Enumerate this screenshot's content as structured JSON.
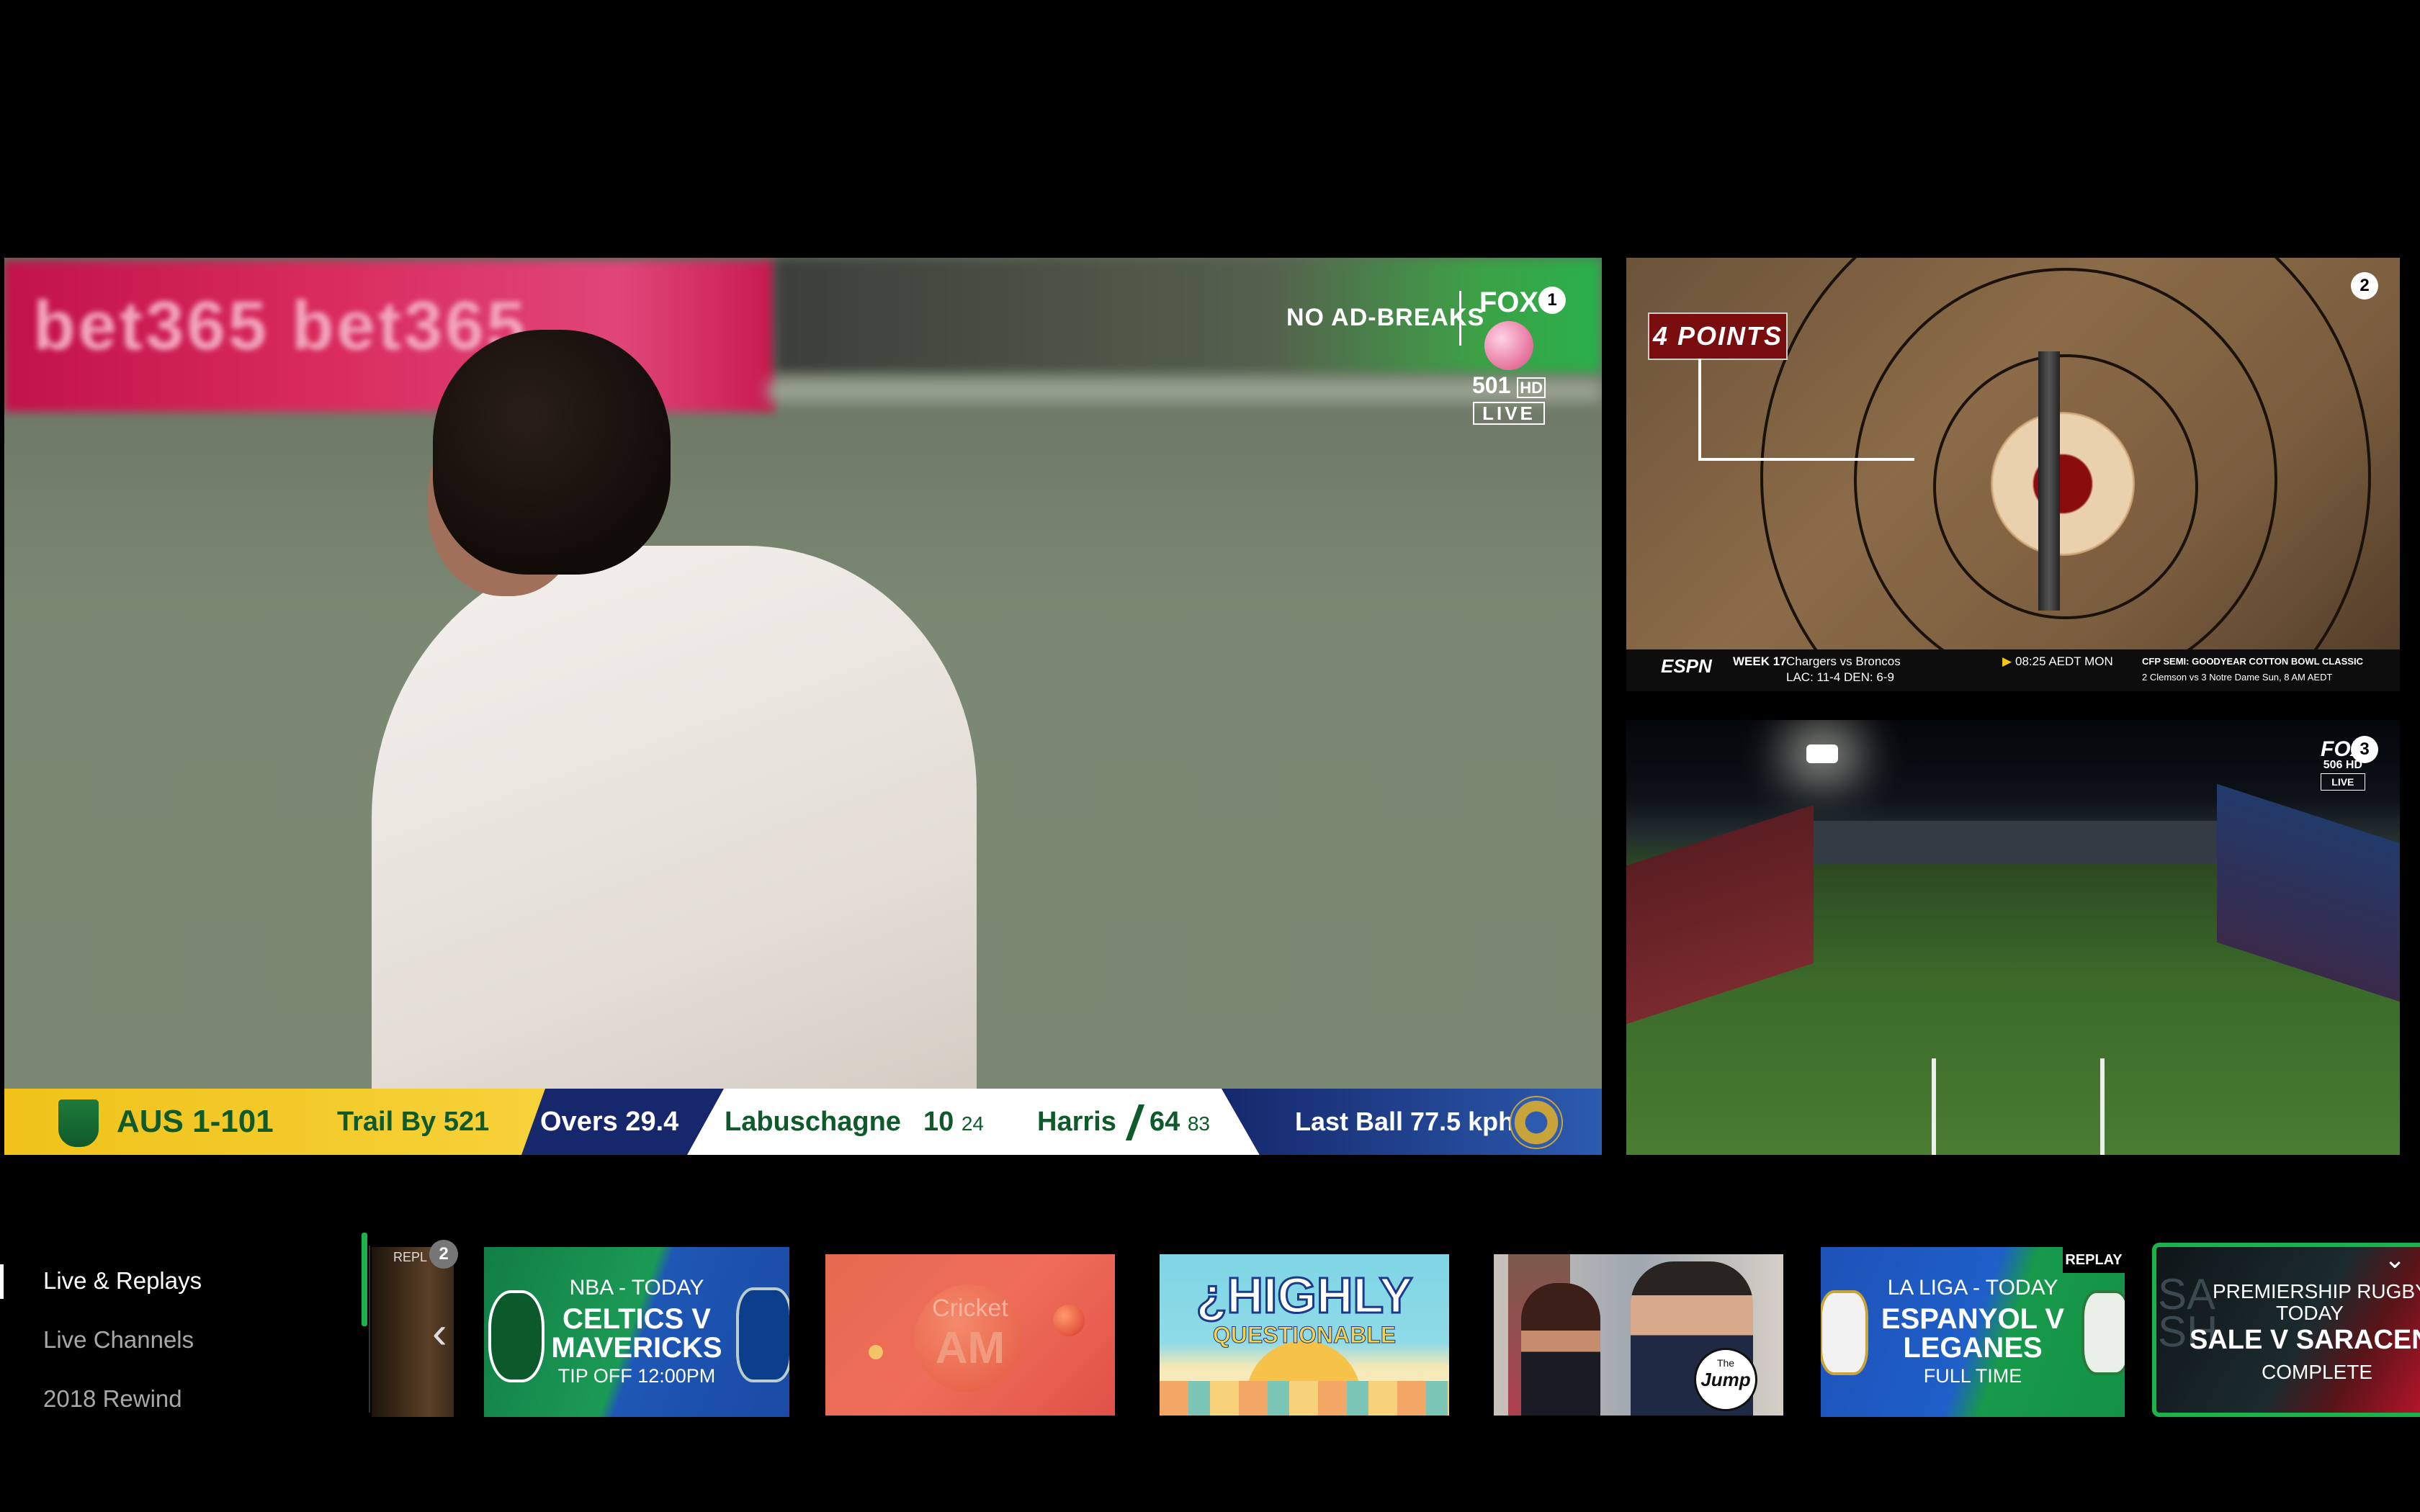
{
  "main_player": {
    "badge_number": "1",
    "no_ad_breaks": "NO AD-BREAKS",
    "channel_brand": "FOX",
    "channel_number": "501",
    "channel_hd": "HD",
    "live_label": "LIVE",
    "sponsor_banner": "bet365 bet365"
  },
  "scoreboard": {
    "team_score": "AUS 1-101",
    "trail": "Trail By 521",
    "overs": "Overs 29.4",
    "batter1_name": "Labuschagne",
    "batter1_runs": "10",
    "batter1_balls": "24",
    "batter2_name": "Harris",
    "batter2_runs": "64",
    "batter2_balls": "83",
    "last_ball": "Last Ball 77.5 kph"
  },
  "feed2": {
    "badge_number": "2",
    "points_label": "4 POINTS",
    "ticker": {
      "network": "ESPN",
      "week": "WEEK 17",
      "matchup": "Chargers vs Broncos",
      "records": "LAC: 11-4   DEN: 6-9",
      "time": "08:25 AEDT MON",
      "promo_line1": "CFP SEMI: GOODYEAR COTTON BOWL CLASSIC",
      "promo_line2": "2 Clemson vs 3 Notre Dame Sun, 8 AM AEDT"
    }
  },
  "feed3": {
    "badge_number": "3",
    "channel_brand": "FOX",
    "channel_number": "506 HD",
    "live_label": "LIVE"
  },
  "nav": {
    "items": [
      {
        "label": "Live & Replays",
        "active": true
      },
      {
        "label": "Live Channels",
        "active": false
      },
      {
        "label": "2018 Rewind",
        "active": false
      }
    ]
  },
  "rail": {
    "partial_tile": {
      "badge": "2",
      "label": "REPL"
    },
    "tiles": [
      {
        "line1": "NBA - TODAY",
        "line2": "CELTICS V",
        "line3": "MAVERICKS",
        "line4": "TIP OFF 12:00PM"
      },
      {
        "title": "Cricket",
        "subtitle": "AM"
      },
      {
        "title_line1": "¿HIGHLY",
        "title_line2": "QUESTIONABLE"
      },
      {
        "logo_line1": "The",
        "logo_line2": "Jump"
      },
      {
        "replay_badge": "REPLAY",
        "line1": "LA LIGA - TODAY",
        "line2": "ESPANYOL V",
        "line3": "LEGANES",
        "line4": "FULL TIME"
      },
      {
        "line1": "PREMIERSHIP RUGBY -",
        "line2": "TODAY",
        "line3": "SALE V SARACENS",
        "line4": "COMPLETE",
        "bg_text": "SALE SH"
      }
    ]
  },
  "colors": {
    "accent_green": "#19b24b",
    "score_yellow": "#f5c518",
    "score_navy": "#16286b",
    "score_blue": "#2c5bb0",
    "score_green_text": "#0f5a2a"
  }
}
